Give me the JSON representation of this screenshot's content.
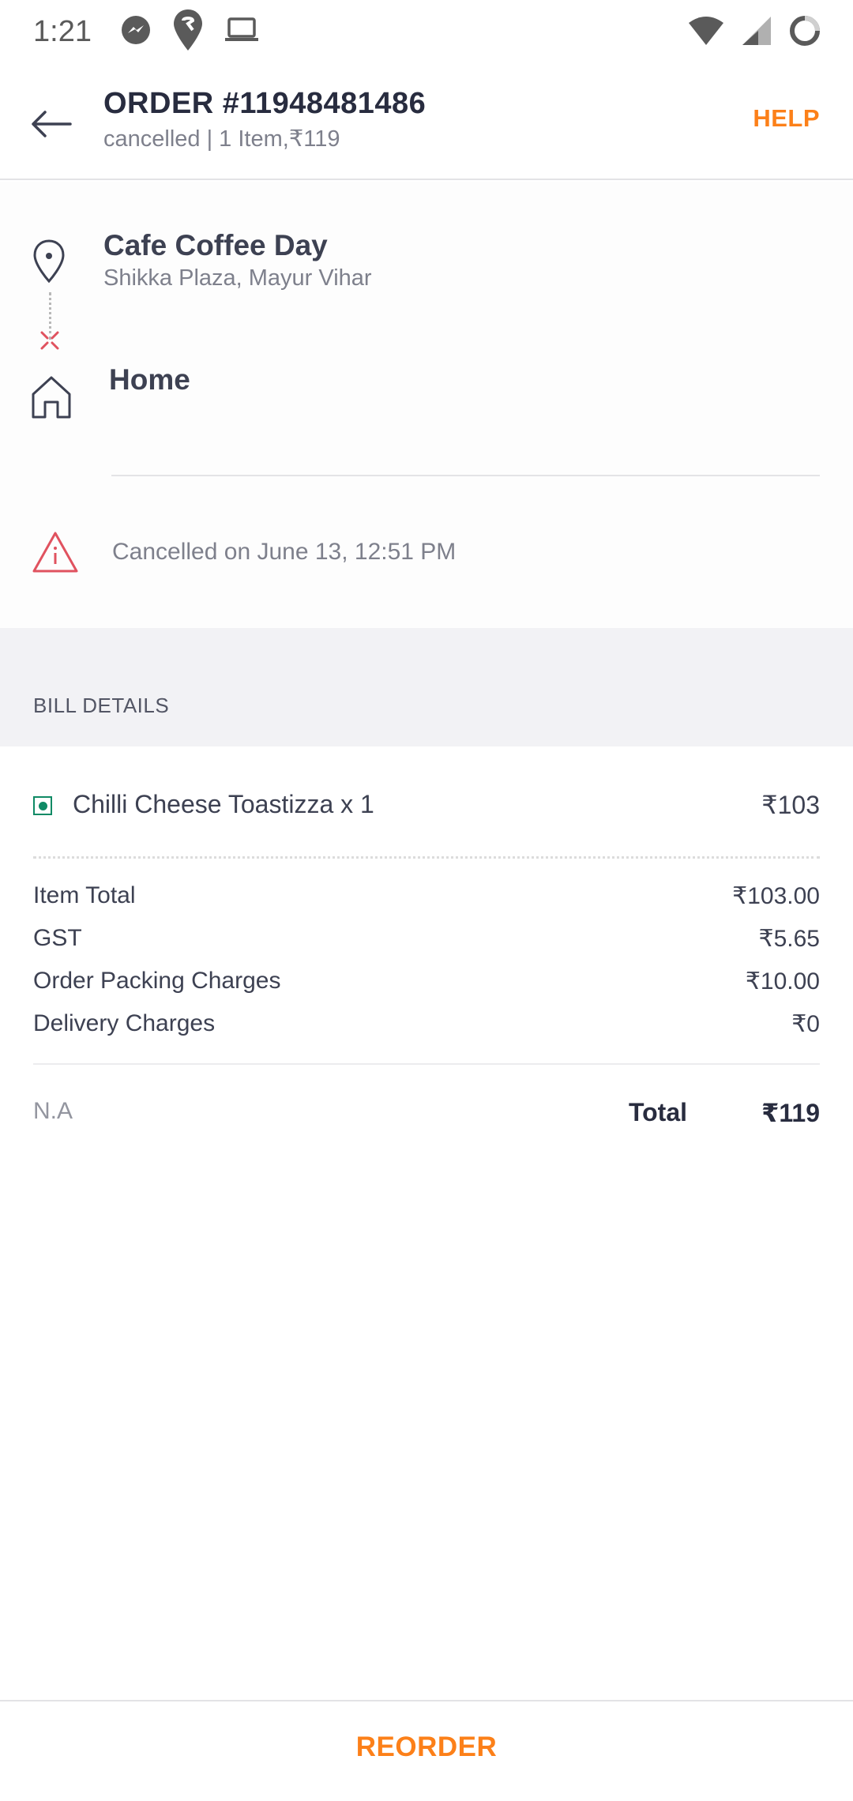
{
  "status_bar": {
    "time": "1:21"
  },
  "header": {
    "title": "ORDER #11948481486",
    "subtitle": "cancelled | 1 Item,₹119",
    "help_label": "HELP"
  },
  "restaurant": {
    "name": "Cafe Coffee Day",
    "location": "Shikka Plaza, Mayur Vihar"
  },
  "delivery": {
    "label": "Home"
  },
  "status": {
    "text": "Cancelled on June 13, 12:51 PM"
  },
  "bill": {
    "heading": "BILL DETAILS",
    "items": [
      {
        "name": "Chilli Cheese Toastizza x 1",
        "price": "₹103"
      }
    ],
    "charges": [
      {
        "label": "Item Total",
        "value": "₹103.00"
      },
      {
        "label": "GST",
        "value": "₹5.65"
      },
      {
        "label": "Order Packing Charges",
        "value": "₹10.00"
      },
      {
        "label": "Delivery Charges",
        "value": "₹0"
      }
    ],
    "payment_note": "N.A",
    "total_label": "Total",
    "total_value": "₹119"
  },
  "footer": {
    "reorder_label": "REORDER"
  },
  "colors": {
    "accent": "#fc8019",
    "veg": "#0f8a65",
    "alert": "#e0525f"
  },
  "icons": [
    "messenger-icon",
    "swiggy-icon",
    "laptop-icon",
    "wifi-icon",
    "signal-icon",
    "battery-icon",
    "back-arrow-icon",
    "location-pin-icon",
    "home-icon",
    "alert-icon",
    "veg-icon"
  ]
}
